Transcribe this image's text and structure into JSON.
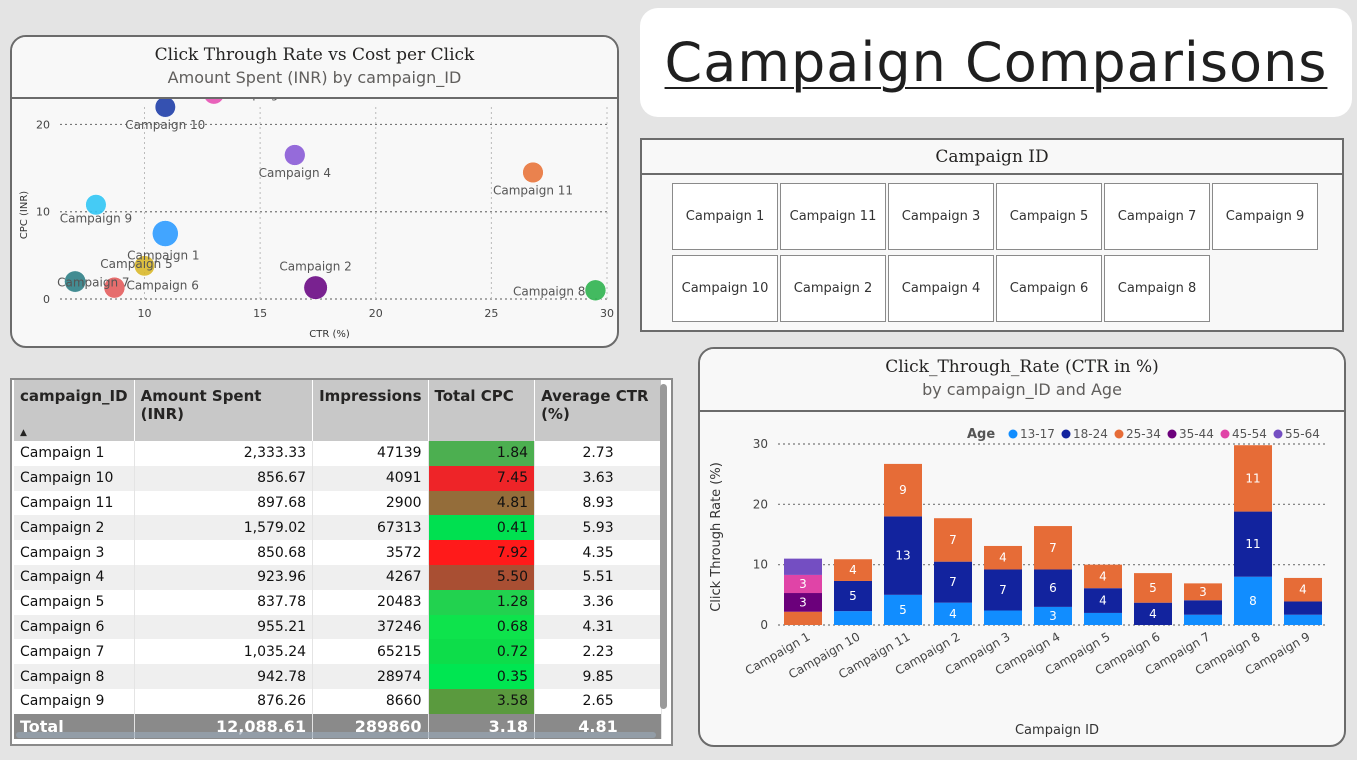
{
  "page": {
    "title": "Campaign Comparisons"
  },
  "scatter": {
    "title": "Click Through Rate vs Cost per Click",
    "subtitle": "Amount Spent (INR) by campaign_ID"
  },
  "slicer": {
    "title": "Campaign ID",
    "items": [
      "Campaign 1",
      "Campaign 11",
      "Campaign 3",
      "Campaign 5",
      "Campaign 7",
      "Campaign 9",
      "Campaign 10",
      "Campaign 2",
      "Campaign 4",
      "Campaign 6",
      "Campaign 8"
    ]
  },
  "table": {
    "columns": [
      "campaign_ID",
      "Amount Spent (INR)",
      "Impressions",
      "Total CPC",
      "Average CTR (%)"
    ],
    "rows": [
      {
        "id": "Campaign 1",
        "amount": "2,333.33",
        "impr": "47139",
        "cpc": "1.84",
        "ctr": "2.73",
        "color": "#4caf50"
      },
      {
        "id": "Campaign 10",
        "amount": "856.67",
        "impr": "4091",
        "cpc": "7.45",
        "ctr": "3.63",
        "color": "#ee2428"
      },
      {
        "id": "Campaign 11",
        "amount": "897.68",
        "impr": "2900",
        "cpc": "4.81",
        "ctr": "8.93",
        "color": "#946d3a"
      },
      {
        "id": "Campaign 2",
        "amount": "1,579.02",
        "impr": "67313",
        "cpc": "0.41",
        "ctr": "5.93",
        "color": "#00e050"
      },
      {
        "id": "Campaign 3",
        "amount": "850.68",
        "impr": "3572",
        "cpc": "7.92",
        "ctr": "4.35",
        "color": "#ff1a1a"
      },
      {
        "id": "Campaign 4",
        "amount": "923.96",
        "impr": "4267",
        "cpc": "5.50",
        "ctr": "5.51",
        "color": "#a94f33"
      },
      {
        "id": "Campaign 5",
        "amount": "837.78",
        "impr": "20483",
        "cpc": "1.28",
        "ctr": "3.36",
        "color": "#22d24f"
      },
      {
        "id": "Campaign 6",
        "amount": "955.21",
        "impr": "37246",
        "cpc": "0.68",
        "ctr": "4.31",
        "color": "#0ee34c"
      },
      {
        "id": "Campaign 7",
        "amount": "1,035.24",
        "impr": "65215",
        "cpc": "0.72",
        "ctr": "2.23",
        "color": "#0ddd4a"
      },
      {
        "id": "Campaign 8",
        "amount": "942.78",
        "impr": "28974",
        "cpc": "0.35",
        "ctr": "9.85",
        "color": "#00e651"
      },
      {
        "id": "Campaign 9",
        "amount": "876.26",
        "impr": "8660",
        "cpc": "3.58",
        "ctr": "2.65",
        "color": "#5a9a3e"
      }
    ],
    "total": {
      "label": "Total",
      "amount": "12,088.61",
      "impr": "289860",
      "cpc": "3.18",
      "ctr": "4.81"
    }
  },
  "bar": {
    "title": "Click_Through_Rate (CTR in %)",
    "subtitle": "by campaign_ID and Age"
  },
  "chart_data": [
    {
      "type": "scatter",
      "title": "Click Through Rate vs Cost per Click",
      "subtitle": "Amount Spent (INR) by campaign_ID",
      "xlabel": "CTR (%)",
      "ylabel": "CPC (INR)",
      "xlim": [
        6,
        30
      ],
      "ylim": [
        0,
        22
      ],
      "xticks": [
        10,
        15,
        20,
        25,
        30
      ],
      "yticks": [
        0,
        10,
        20
      ],
      "grid": true,
      "points": [
        {
          "label": "Campaign 1",
          "x": 10.9,
          "y": 7.5,
          "size": 2333.33,
          "color": "#2e9bff"
        },
        {
          "label": "Campaign 10",
          "x": 10.9,
          "y": 22.0,
          "size": 856.67,
          "color": "#1f3ea8"
        },
        {
          "label": "Campaign 11",
          "x": 26.8,
          "y": 14.5,
          "size": 897.68,
          "color": "#e8743b"
        },
        {
          "label": "Campaign 2",
          "x": 17.4,
          "y": 1.3,
          "size": 1579.02,
          "color": "#6a0a84"
        },
        {
          "label": "Campaign 3",
          "x": 13.0,
          "y": 23.5,
          "size": 850.68,
          "color": "#e651b2"
        },
        {
          "label": "Campaign 4",
          "x": 16.5,
          "y": 16.5,
          "size": 923.96,
          "color": "#8a5bd6"
        },
        {
          "label": "Campaign 5",
          "x": 10.0,
          "y": 3.8,
          "size": 837.78,
          "color": "#d9b82b"
        },
        {
          "label": "Campaign 6",
          "x": 8.7,
          "y": 1.3,
          "size": 955.21,
          "color": "#e35d5d"
        },
        {
          "label": "Campaign 7",
          "x": 7.0,
          "y": 2.0,
          "size": 1035.24,
          "color": "#2f7f86"
        },
        {
          "label": "Campaign 8",
          "x": 29.5,
          "y": 1.0,
          "size": 942.78,
          "color": "#2fb34f"
        },
        {
          "label": "Campaign 9",
          "x": 7.9,
          "y": 10.8,
          "size": 876.26,
          "color": "#31c5f4"
        }
      ]
    },
    {
      "type": "bar",
      "stacked": true,
      "title": "Click_Through_Rate (CTR in %)",
      "subtitle": "by campaign_ID and Age",
      "xlabel": "Campaign ID",
      "ylabel": "Click Through Rate (%)",
      "ylim": [
        0,
        30
      ],
      "yticks": [
        0,
        10,
        20,
        30
      ],
      "legend_title": "Age",
      "legend_position": "top-right",
      "categories": [
        "Campaign 1",
        "Campaign 10",
        "Campaign 11",
        "Campaign 2",
        "Campaign 3",
        "Campaign 4",
        "Campaign 5",
        "Campaign 6",
        "Campaign 7",
        "Campaign 8",
        "Campaign 9"
      ],
      "series": [
        {
          "name": "13-17",
          "color": "#118dff",
          "values": [
            0,
            2.3,
            5,
            3.7,
            2.4,
            3,
            2,
            0,
            1.7,
            8,
            1.7
          ]
        },
        {
          "name": "18-24",
          "color": "#12239e",
          "values": [
            0,
            5,
            13,
            6.8,
            6.8,
            6.2,
            4.1,
            3.7,
            2.4,
            10.8,
            2.2
          ]
        },
        {
          "name": "25-34",
          "color": "#e66c37",
          "values": [
            2.2,
            3.6,
            8.7,
            7.2,
            3.9,
            7.2,
            3.9,
            4.9,
            2.8,
            11,
            3.9
          ]
        },
        {
          "name": "35-44",
          "color": "#6b007b",
          "values": [
            3.1,
            0,
            0,
            0,
            0,
            0,
            0,
            0,
            0,
            0,
            0
          ]
        },
        {
          "name": "45-54",
          "color": "#e044a7",
          "values": [
            3.0,
            0,
            0,
            0,
            0,
            0,
            0,
            0,
            0,
            0,
            0
          ]
        },
        {
          "name": "55-64",
          "color": "#744ec2",
          "values": [
            2.7,
            0,
            0,
            0,
            0,
            0,
            0,
            0,
            0,
            0,
            0
          ]
        }
      ],
      "data_labels": [
        {
          "category": "Campaign 1",
          "series": "35-44",
          "text": "3"
        },
        {
          "category": "Campaign 1",
          "series": "45-54",
          "text": "3"
        },
        {
          "category": "Campaign 10",
          "series": "18-24",
          "text": "5"
        },
        {
          "category": "Campaign 10",
          "series": "25-34",
          "text": "4"
        },
        {
          "category": "Campaign 11",
          "series": "13-17",
          "text": "5"
        },
        {
          "category": "Campaign 11",
          "series": "18-24",
          "text": "13"
        },
        {
          "category": "Campaign 11",
          "series": "25-34",
          "text": "9"
        },
        {
          "category": "Campaign 2",
          "series": "13-17",
          "text": "4"
        },
        {
          "category": "Campaign 2",
          "series": "18-24",
          "text": "7"
        },
        {
          "category": "Campaign 2",
          "series": "25-34",
          "text": "7"
        },
        {
          "category": "Campaign 3",
          "series": "18-24",
          "text": "7"
        },
        {
          "category": "Campaign 3",
          "series": "25-34",
          "text": "4"
        },
        {
          "category": "Campaign 4",
          "series": "13-17",
          "text": "3"
        },
        {
          "category": "Campaign 4",
          "series": "18-24",
          "text": "6"
        },
        {
          "category": "Campaign 4",
          "series": "25-34",
          "text": "7"
        },
        {
          "category": "Campaign 5",
          "series": "18-24",
          "text": "4"
        },
        {
          "category": "Campaign 5",
          "series": "25-34",
          "text": "4"
        },
        {
          "category": "Campaign 6",
          "series": "18-24",
          "text": "4"
        },
        {
          "category": "Campaign 6",
          "series": "25-34",
          "text": "5"
        },
        {
          "category": "Campaign 7",
          "series": "25-34",
          "text": "3"
        },
        {
          "category": "Campaign 8",
          "series": "13-17",
          "text": "8"
        },
        {
          "category": "Campaign 8",
          "series": "18-24",
          "text": "11"
        },
        {
          "category": "Campaign 8",
          "series": "25-34",
          "text": "11"
        },
        {
          "category": "Campaign 9",
          "series": "25-34",
          "text": "4"
        }
      ]
    }
  ]
}
